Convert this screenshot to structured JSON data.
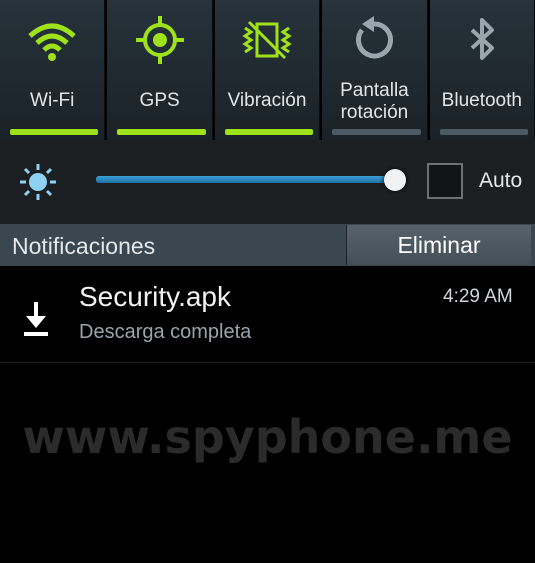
{
  "quick_settings": [
    {
      "label": "Wi-Fi",
      "icon": "wifi-icon",
      "active": true
    },
    {
      "label": "GPS",
      "icon": "gps-icon",
      "active": true
    },
    {
      "label": "Vibración",
      "icon": "vibration-icon",
      "active": true
    },
    {
      "label": "Pantalla rotación",
      "icon": "rotation-icon",
      "active": false
    },
    {
      "label": "Bluetooth",
      "icon": "bluetooth-icon",
      "active": false
    }
  ],
  "brightness": {
    "level": 0.99,
    "auto_label": "Auto",
    "auto_checked": false
  },
  "notifications": {
    "title": "Notificaciones",
    "clear_label": "Eliminar",
    "items": [
      {
        "title": "Security.apk",
        "subtitle": "Descarga completa",
        "time": "4:29 AM",
        "icon": "download-icon"
      }
    ]
  },
  "watermark": "www.spyphone.me",
  "colors": {
    "accent": "#9ee21a",
    "slider": "#3aa0d8"
  }
}
